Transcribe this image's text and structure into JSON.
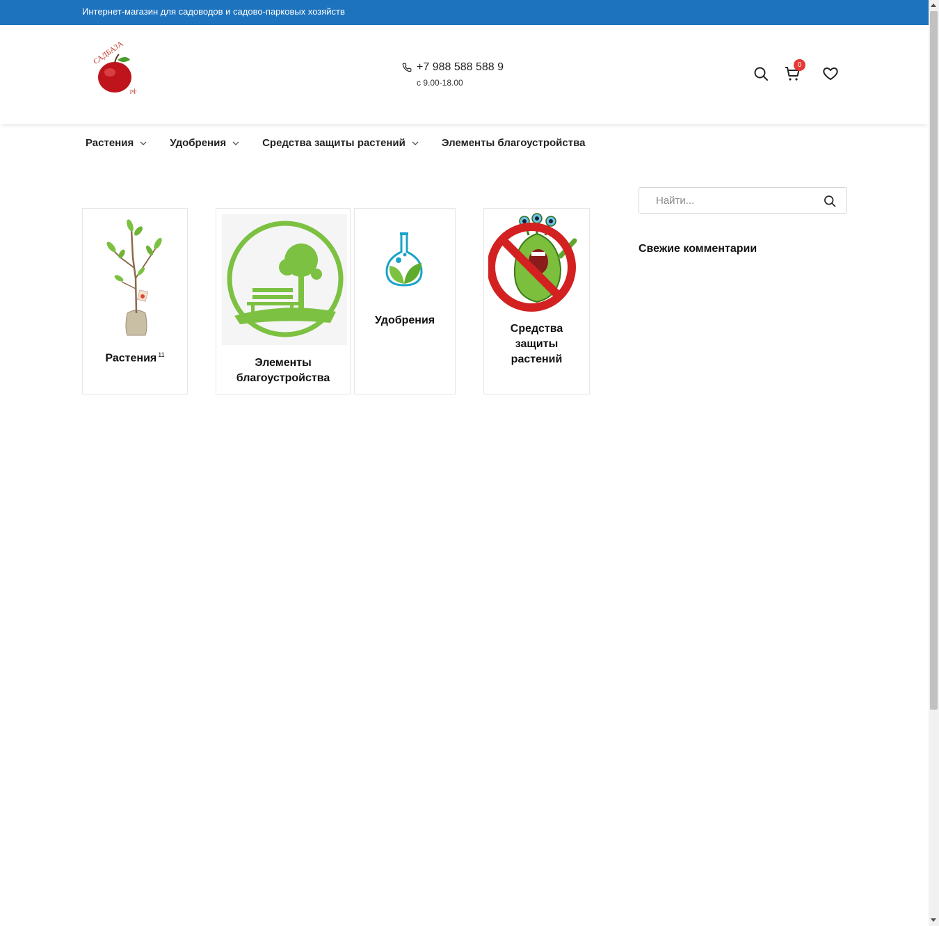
{
  "topbar": {
    "tagline": "Интернет-магазин для садоводов и садово-парковых хозяйств"
  },
  "header": {
    "logo_text": "САДБАЗА",
    "logo_sub": "рф",
    "phone": "+7 988 588 588 9",
    "hours": "с 9.00-18.00",
    "cart_count": "0"
  },
  "nav": {
    "items": [
      {
        "label": "Растения",
        "has_dropdown": true
      },
      {
        "label": "Удобрения",
        "has_dropdown": true
      },
      {
        "label": "Средства защиты растений",
        "has_dropdown": true
      },
      {
        "label": "Элементы благоустройства",
        "has_dropdown": false
      }
    ]
  },
  "categories": [
    {
      "title": "Растения",
      "count": "11",
      "icon": "sapling-in-sack-image"
    },
    {
      "title_line1": "Элементы",
      "title_line2": "благоустройства",
      "icon": "park-bench-tree-image"
    },
    {
      "title": "Удобрения",
      "icon": "flask-leaf-image"
    },
    {
      "title_line1": "Средства",
      "title_line2": "защиты",
      "title_line3": "растений",
      "icon": "no-pest-monster-image"
    }
  ],
  "sidebar": {
    "search_placeholder": "Найти...",
    "widget_title": "Свежие комментарии"
  },
  "colors": {
    "topbar": "#1e73be",
    "badge": "#e53935",
    "green": "#7cc142",
    "teal": "#1aa3c9"
  }
}
